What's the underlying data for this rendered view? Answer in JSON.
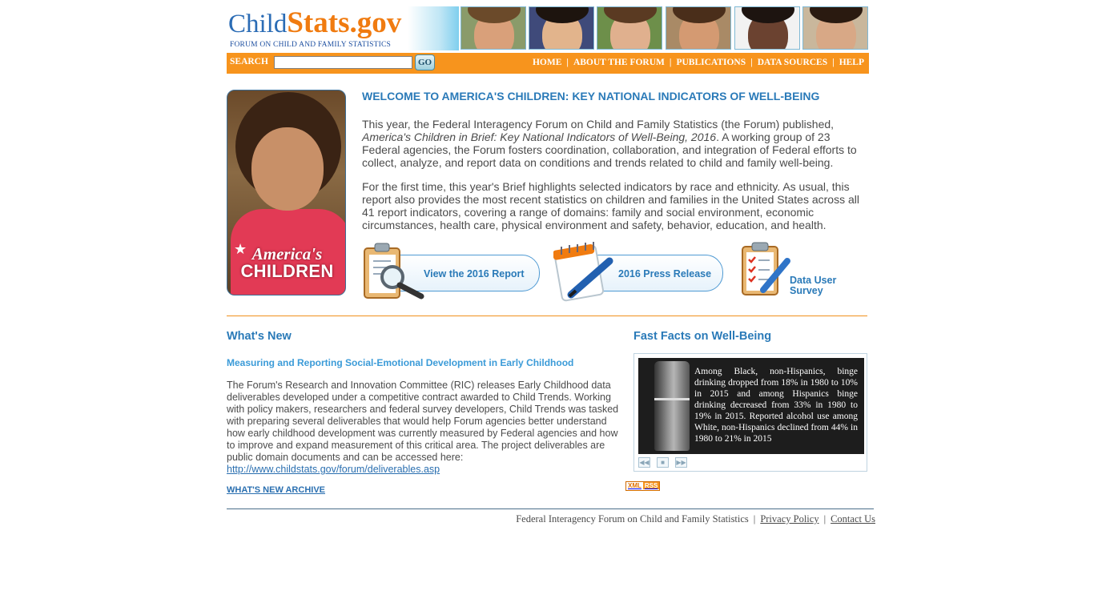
{
  "header": {
    "logo_child": "Child",
    "logo_stats": "Stats.gov",
    "logo_tagline": "FORUM ON CHILD AND FAMILY STATISTICS"
  },
  "search": {
    "label": "SEARCH",
    "value": "",
    "placeholder": "",
    "go_label": "GO"
  },
  "nav": {
    "items": [
      {
        "label": "HOME"
      },
      {
        "label": "ABOUT THE FORUM"
      },
      {
        "label": "PUBLICATIONS"
      },
      {
        "label": "DATA SOURCES"
      },
      {
        "label": "HELP"
      }
    ],
    "separator": "|"
  },
  "hero": {
    "brand_line1": "America's",
    "brand_line2": "CHILDREN"
  },
  "welcome": {
    "title": "WELCOME TO AMERICA'S CHILDREN: KEY NATIONAL INDICATORS OF WELL-BEING",
    "p1_start": "This year, the Federal Interagency Forum on Child and Family Statistics (the Forum) published, ",
    "p1_italic": "America's Children in Brief: Key National Indicators of Well-Being, 2016",
    "p1_end": ". A working group of 23 Federal agencies, the Forum fosters coordination, collaboration, and integration of Federal efforts to collect, analyze, and report data on conditions and trends related to child and family well-being.",
    "p2": "For the first time, this year's Brief highlights selected indicators by race and ethnicity. As usual, this report also provides the most recent statistics on children and families in the United States across all 41 report indicators, covering a range of domains: family and social environment, economic circumstances, health care, physical environment and safety, behavior, education, and health."
  },
  "cta": {
    "report": "View the 2016 Report",
    "press": "2016 Press Release",
    "survey_line1": "Data User",
    "survey_line2": "Survey"
  },
  "whats_new": {
    "title": "What's New",
    "headline": "Measuring and Reporting Social-Emotional Development in Early Childhood",
    "body": "The Forum's Research and Innovation Committee (RIC) releases Early Childhood data deliverables developed under a competitive contract awarded to Child Trends. Working with policy makers, researchers and federal survey developers, Child Trends was tasked with preparing several deliverables that would help Forum agencies better understand how early childhood development was currently measured by Federal agencies and how to improve and expand measurement of this critical area. The project deliverables are public domain documents and can be accessed here:",
    "link": "http://www.childstats.gov/forum/deliverables.asp",
    "archive": "WHAT'S NEW ARCHIVE"
  },
  "fast_facts": {
    "title": "Fast Facts on Well-Being",
    "text": "Among Black, non-Hispanics, binge drinking dropped from 18% in 1980 to 10% in 2015 and among Hispanics binge drinking decreased from 33% in 1980 to 19% in 2015. Reported alcohol use among White, non-Hispanics declined from 44% in 1980 to 21% in 2015",
    "rss_xml": "XML",
    "rss_rss": "RSS"
  },
  "footer": {
    "org": "Federal Interagency Forum on Child and Family Statistics",
    "privacy": "Privacy Policy",
    "contact": "Contact Us",
    "separator": "|"
  },
  "colors": {
    "orange": "#f7941d",
    "blue_heading": "#2a7ab8",
    "link_blue": "#2a6fb0"
  }
}
